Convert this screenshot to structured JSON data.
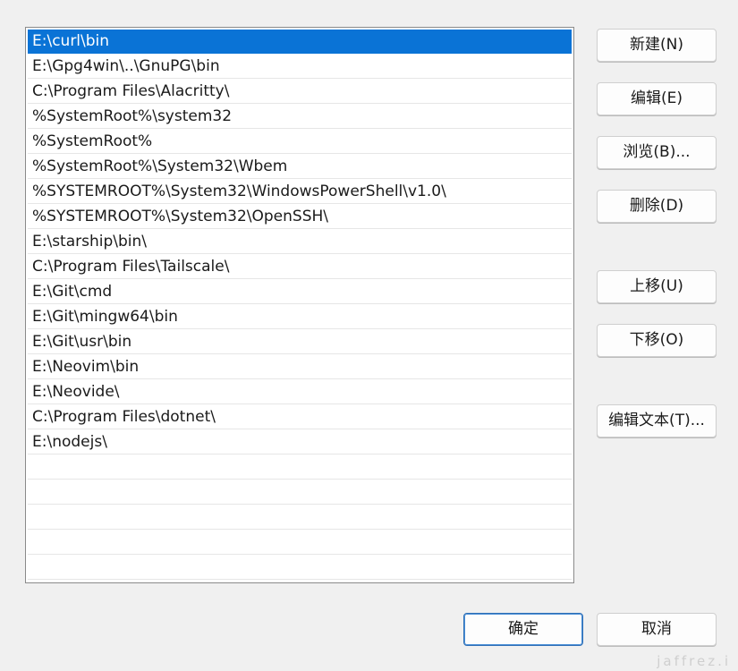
{
  "paths": [
    "E:\\curl\\bin",
    "E:\\Gpg4win\\..\\GnuPG\\bin",
    "C:\\Program Files\\Alacritty\\",
    "%SystemRoot%\\system32",
    "%SystemRoot%",
    "%SystemRoot%\\System32\\Wbem",
    "%SYSTEMROOT%\\System32\\WindowsPowerShell\\v1.0\\",
    "%SYSTEMROOT%\\System32\\OpenSSH\\",
    "E:\\starship\\bin\\",
    "C:\\Program Files\\Tailscale\\",
    "E:\\Git\\cmd",
    "E:\\Git\\mingw64\\bin",
    "E:\\Git\\usr\\bin",
    "E:\\Neovim\\bin",
    "E:\\Neovide\\",
    "C:\\Program Files\\dotnet\\",
    "E:\\nodejs\\",
    "",
    "",
    "",
    "",
    "",
    ""
  ],
  "buttons": {
    "new": "新建(N)",
    "edit": "编辑(E)",
    "browse": "浏览(B)...",
    "delete": "删除(D)",
    "move_up": "上移(U)",
    "move_down": "下移(O)",
    "edit_text": "编辑文本(T)...",
    "ok": "确定",
    "cancel": "取消"
  },
  "colors": {
    "selection": "#0a73d6",
    "background": "#f0f0f0"
  },
  "watermark": "jaffrez.i"
}
